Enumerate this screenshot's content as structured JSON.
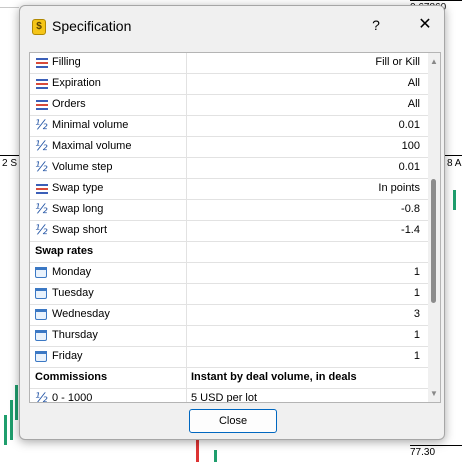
{
  "background": {
    "price_top": "0.67860",
    "price_bottom": "77.30",
    "left_label": "2 S",
    "right_label": "8 A"
  },
  "dialog": {
    "title": "Specification",
    "help_glyph": "?",
    "close_glyph": "✕",
    "close_button_label": "Close"
  },
  "rows": [
    {
      "type": "item",
      "icon": "list-icon",
      "label": "Filling",
      "value": "Fill or Kill"
    },
    {
      "type": "item",
      "icon": "list-icon",
      "label": "Expiration",
      "value": "All"
    },
    {
      "type": "item",
      "icon": "list-icon",
      "label": "Orders",
      "value": "All"
    },
    {
      "type": "item",
      "icon": "half-icon",
      "label": "Minimal volume",
      "value": "0.01"
    },
    {
      "type": "item",
      "icon": "half-icon",
      "label": "Maximal volume",
      "value": "100"
    },
    {
      "type": "item",
      "icon": "half-icon",
      "label": "Volume step",
      "value": "0.01"
    },
    {
      "type": "item",
      "icon": "list-icon",
      "label": "Swap type",
      "value": "In points"
    },
    {
      "type": "item",
      "icon": "half-icon",
      "label": "Swap long",
      "value": "-0.8"
    },
    {
      "type": "item",
      "icon": "half-icon",
      "label": "Swap short",
      "value": "-1.4"
    },
    {
      "type": "section",
      "label": "Swap rates",
      "value": ""
    },
    {
      "type": "item",
      "icon": "calendar-icon",
      "label": "Monday",
      "value": "1"
    },
    {
      "type": "item",
      "icon": "calendar-icon",
      "label": "Tuesday",
      "value": "1"
    },
    {
      "type": "item",
      "icon": "calendar-icon",
      "label": "Wednesday",
      "value": "3"
    },
    {
      "type": "item",
      "icon": "calendar-icon",
      "label": "Thursday",
      "value": "1"
    },
    {
      "type": "item",
      "icon": "calendar-icon",
      "label": "Friday",
      "value": "1"
    },
    {
      "type": "section",
      "label": "Commissions",
      "value": "Instant by deal volume, in deals"
    },
    {
      "type": "plain",
      "icon": "half-icon",
      "label": "0 - 1000",
      "value": "5 USD per lot"
    }
  ]
}
